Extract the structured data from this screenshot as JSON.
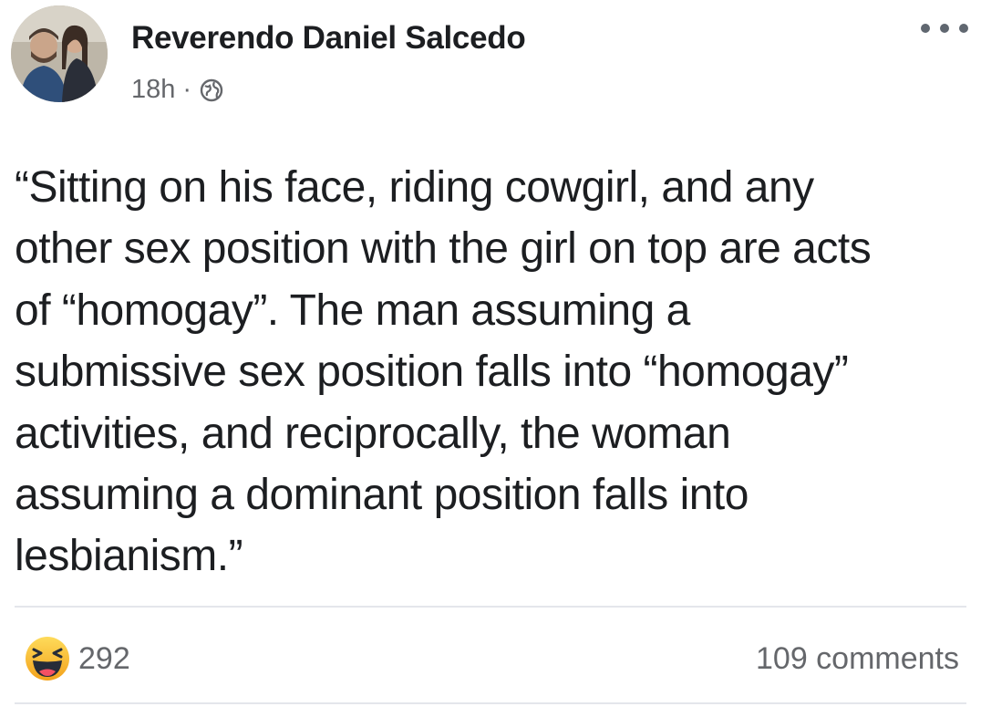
{
  "post": {
    "author": "Reverendo Daniel Salcedo",
    "time": "18h",
    "separator": "·",
    "privacy_icon": "globe-icon",
    "menu_icon": "more-options-icon",
    "text_lines": [
      "“Sitting on his face, riding cowgirl, and any",
      "other sex position with the girl on top are acts",
      "of “homogay”. The man assuming a",
      "submissive sex position falls into “homogay”",
      "activities, and reciprocally, the woman",
      "assuming a dominant position falls into",
      "lesbianism.”"
    ],
    "reaction_icon": "haha-reaction-icon",
    "reaction_count": "292",
    "comments": "109 comments"
  },
  "colors": {
    "text": "#1c1e21",
    "secondary": "#65676b",
    "divider": "#e4e6eb",
    "haha_yellow": "#f7b125"
  }
}
